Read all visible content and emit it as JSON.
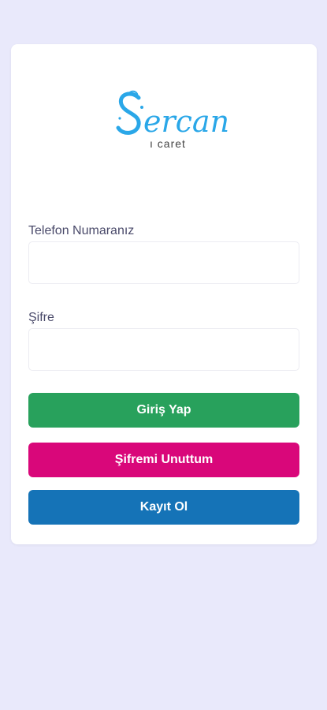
{
  "logo": {
    "word": "ercan",
    "initial": "S",
    "subtitle": "ı caret"
  },
  "form": {
    "phone_label": "Telefon Numaranız",
    "phone_value": "",
    "password_label": "Şifre",
    "password_value": ""
  },
  "buttons": {
    "login": "Giriş Yap",
    "forgot": "Şifremi Unuttum",
    "register": "Kayıt Ol"
  },
  "colors": {
    "background": "#e9e9fb",
    "login": "#28a15c",
    "forgot": "#d9077a",
    "register": "#1573b7",
    "logo": "#2aa7e8"
  }
}
